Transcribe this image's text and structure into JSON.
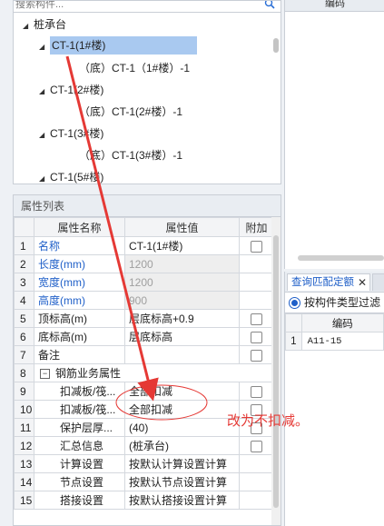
{
  "search": {
    "placeholder": "搜索构件..."
  },
  "tree": {
    "root_label": "桩承台",
    "groups": [
      {
        "label": "CT-1(1#楼)",
        "child": "（底）CT-1（1#楼）-1"
      },
      {
        "label": "CT-1(2#楼)",
        "child": "（底）CT-1(2#楼）-1"
      },
      {
        "label": "CT-1(3#楼)",
        "child": "（底）CT-1(3#楼）-1"
      },
      {
        "label": "CT-1(5#楼)"
      }
    ]
  },
  "right_top": {
    "header": "编码"
  },
  "props": {
    "title": "属性列表",
    "columns": [
      "属性名称",
      "属性值",
      "附加"
    ],
    "rows": [
      {
        "num": "1",
        "name": "名称",
        "value": "CT-1(1#楼)"
      },
      {
        "num": "2",
        "name": "长度(mm)",
        "value": "1200"
      },
      {
        "num": "3",
        "name": "宽度(mm)",
        "value": "1200"
      },
      {
        "num": "4",
        "name": "高度(mm)",
        "value": "900"
      },
      {
        "num": "5",
        "name": "顶标高(m)",
        "value": "层底标高+0.9"
      },
      {
        "num": "6",
        "name": "底标高(m)",
        "value": "层底标高"
      },
      {
        "num": "7",
        "name": "备注",
        "value": ""
      },
      {
        "num": "8",
        "name": "钢筋业务属性",
        "value": ""
      },
      {
        "num": "9",
        "name": "扣减板/筏...",
        "value": "全部扣减"
      },
      {
        "num": "10",
        "name": "扣减板/筏...",
        "value": "全部扣减"
      },
      {
        "num": "11",
        "name": "保护层厚...",
        "value": "(40)"
      },
      {
        "num": "12",
        "name": "汇总信息",
        "value": "(桩承台)"
      },
      {
        "num": "13",
        "name": "计算设置",
        "value": "按默认计算设置计算"
      },
      {
        "num": "14",
        "name": "节点设置",
        "value": "按默认节点设置计算"
      },
      {
        "num": "15",
        "name": "搭接设置",
        "value": "按默认搭接设置计算"
      }
    ]
  },
  "query": {
    "tab_label": "查询匹配定额",
    "filter_label": "按构件类型过滤",
    "col_header": "编码",
    "rows": [
      {
        "num": "1",
        "code": "A11-15"
      }
    ]
  },
  "annotation": {
    "note": "改为不扣减。",
    "color": "#e53935"
  },
  "colors": {
    "selection": "#a9c9f0",
    "link_blue": "#1f5fc8",
    "annotation_red": "#e53935"
  }
}
